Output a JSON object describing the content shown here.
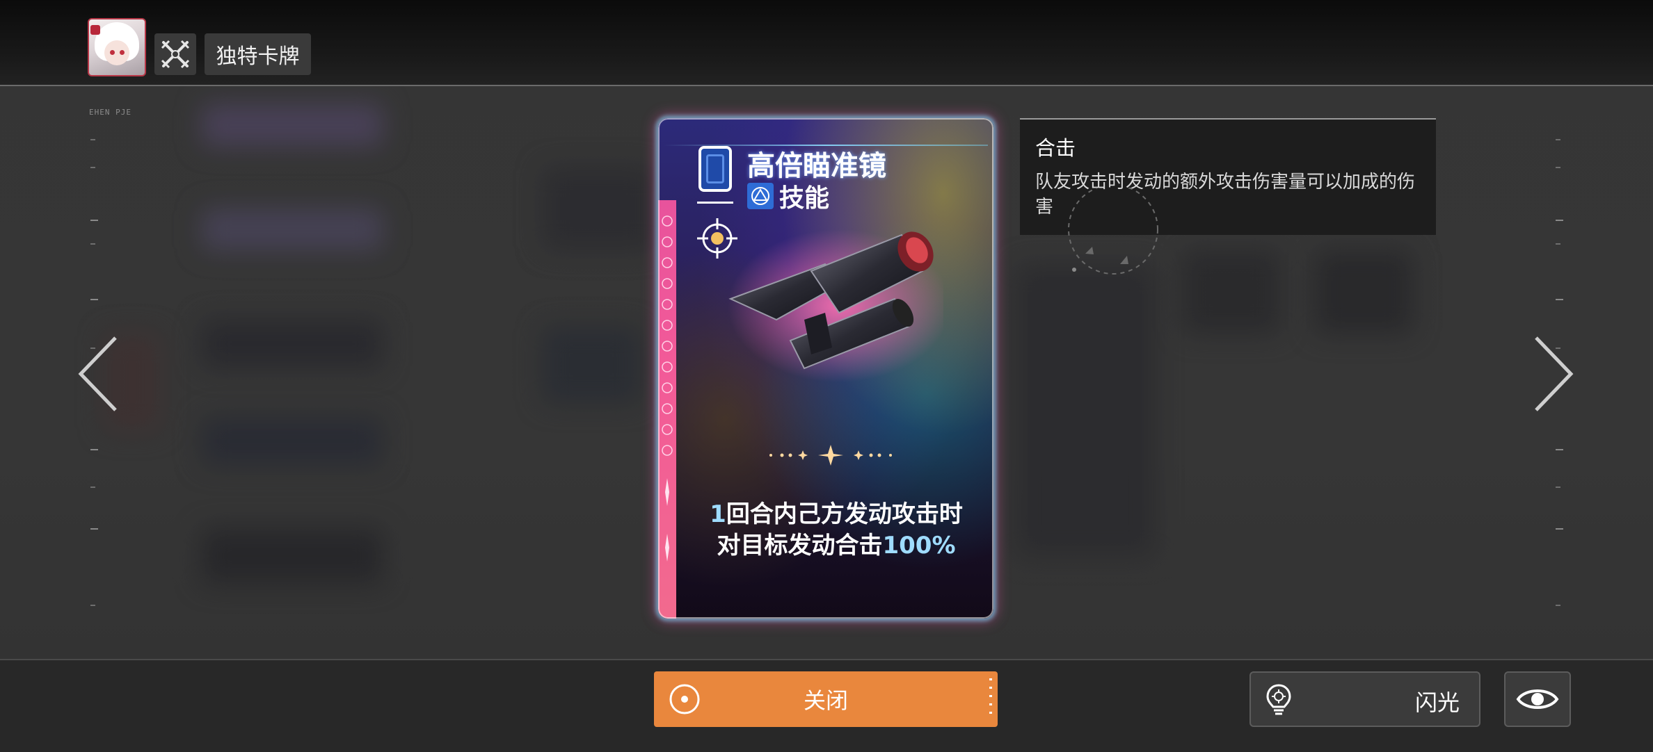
{
  "header": {
    "title": "独特卡牌",
    "avatar_icon": "character-portrait",
    "class_icon": "crossed-swords-icon"
  },
  "rail": {
    "tag": "EHEN PJE"
  },
  "card": {
    "cost": "0",
    "name": "高倍瞄准镜",
    "type": "技能",
    "type_icon": "triangle-in-circle-icon",
    "description_line1_num": "1",
    "description_line1_text": "回合内己方发动攻击时",
    "description_line2_text": "对目标发动合击",
    "description_line2_num": "100%",
    "accent_stripe": "#f25a98",
    "cost_color": "#1f4aa8"
  },
  "tooltip": {
    "title": "合击",
    "text": "队友攻击时发动的额外攻击伤害量可以加成的伤害"
  },
  "navigation": {
    "prev_icon": "chevron-left-icon",
    "next_icon": "chevron-right-icon"
  },
  "actions": {
    "close_label": "关闭",
    "close_color": "#e9873d",
    "flash_label": "闪光",
    "flash_icon": "lightbulb-crosshair-icon",
    "view_icon": "eye-icon"
  }
}
